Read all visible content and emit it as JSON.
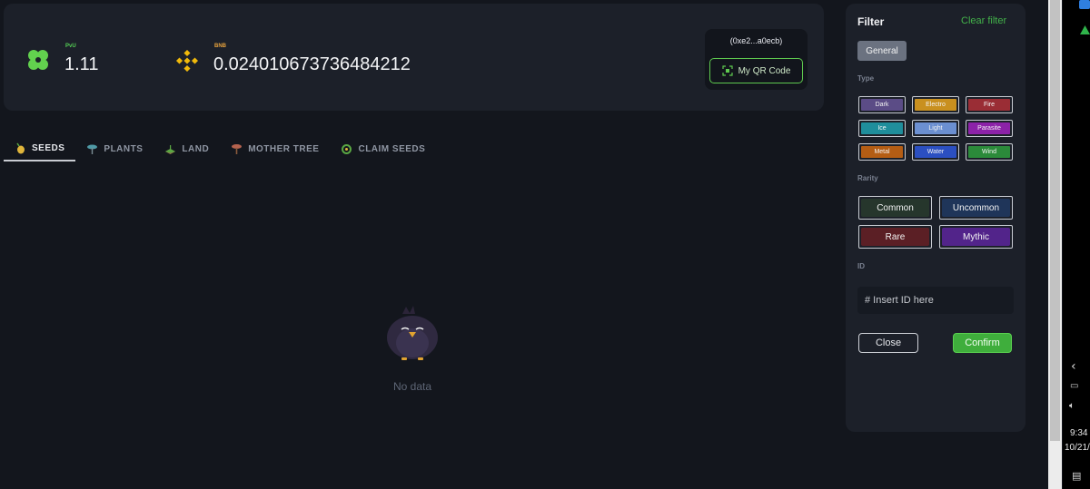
{
  "wallet": {
    "pvu_label": "PvU",
    "pvu_value": "1.11",
    "bnb_label": "BNB",
    "bnb_value": "0.024010673736484212",
    "address": "(0xe2...a0ecb)",
    "qr_label": "My QR Code"
  },
  "tabs": [
    {
      "label": "SEEDS",
      "icon": "seed-icon",
      "active": true
    },
    {
      "label": "PLANTS",
      "icon": "plant-icon",
      "active": false
    },
    {
      "label": "LAND",
      "icon": "land-icon",
      "active": false
    },
    {
      "label": "MOTHER TREE",
      "icon": "mother-tree-icon",
      "active": false
    },
    {
      "label": "CLAIM SEEDS",
      "icon": "claim-seeds-icon",
      "active": false
    }
  ],
  "empty_state": {
    "text": "No data",
    "icon": "sleepy-crow-icon"
  },
  "filter": {
    "title": "Filter",
    "clear_label": "Clear filter",
    "general_label": "General",
    "type_label": "Type",
    "types": [
      {
        "label": "Dark",
        "color": "#5b4c86"
      },
      {
        "label": "Electro",
        "color": "#c9901f"
      },
      {
        "label": "Fire",
        "color": "#9a2d35"
      },
      {
        "label": "Ice",
        "color": "#1f8e9c"
      },
      {
        "label": "Light",
        "color": "#6b8fd1"
      },
      {
        "label": "Parasite",
        "color": "#8c22a8"
      },
      {
        "label": "Metal",
        "color": "#b45d14"
      },
      {
        "label": "Water",
        "color": "#2b4fc1"
      },
      {
        "label": "Wind",
        "color": "#2b8a3a"
      }
    ],
    "rarity_label": "Rarity",
    "rarities": [
      {
        "label": "Common",
        "color": "#26362c"
      },
      {
        "label": "Uncommon",
        "color": "#1f3559"
      },
      {
        "label": "Rare",
        "color": "#5b1f25"
      },
      {
        "label": "Mythic",
        "color": "#52248a"
      }
    ],
    "id_label": "ID",
    "id_placeholder": "# Insert ID here",
    "close_label": "Close",
    "confirm_label": "Confirm"
  },
  "taskbar": {
    "time": "9:34",
    "date": "10/21/"
  },
  "colors": {
    "accent_green": "#43b34a",
    "bnb_gold": "#f0b90b",
    "panel_bg": "#1c2029",
    "page_bg": "#13161d"
  }
}
